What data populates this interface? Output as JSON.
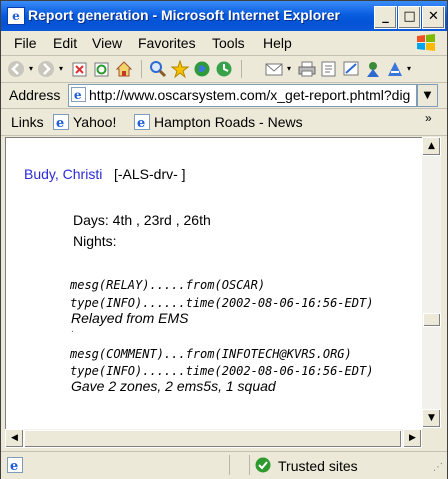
{
  "window": {
    "title": "Report generation - Microsoft Internet Explorer",
    "min_glyph": "_",
    "max_glyph": "□",
    "close_glyph": "✕"
  },
  "menu": [
    "File",
    "Edit",
    "View",
    "Favorites",
    "Tools",
    "Help"
  ],
  "address": {
    "label": "Address",
    "url": "http://www.oscarsystem.com/x_get-report.phtml?dig"
  },
  "links": {
    "label": "Links",
    "items": [
      "Yahoo!",
      "Hampton Roads - News"
    ]
  },
  "report": {
    "person": "Budy, Christi",
    "tag": "[-ALS-drv- ]",
    "days": "Days:   4th , 23rd , 26th",
    "nights": "Nights:",
    "messages": [
      {
        "line1": "mesg(RELAY).....from(OSCAR)",
        "line2": "type(INFO)......time(2002-08-06-16:56-EDT)",
        "body": "Relayed from EMS"
      },
      {
        "line1": "mesg(COMMENT)...from(INFOTECH@KVRS.ORG)",
        "line2": "type(INFO)......time(2002-08-06-16:56-EDT)",
        "body": "Gave 2 zones, 2 ems5s, 1 squad"
      }
    ],
    "separator": "."
  },
  "status": {
    "zone": "Trusted sites"
  },
  "colors": {
    "titlebar": "#0a5de0",
    "link": "#2b2bd6",
    "chrome": "#ece9d8"
  }
}
